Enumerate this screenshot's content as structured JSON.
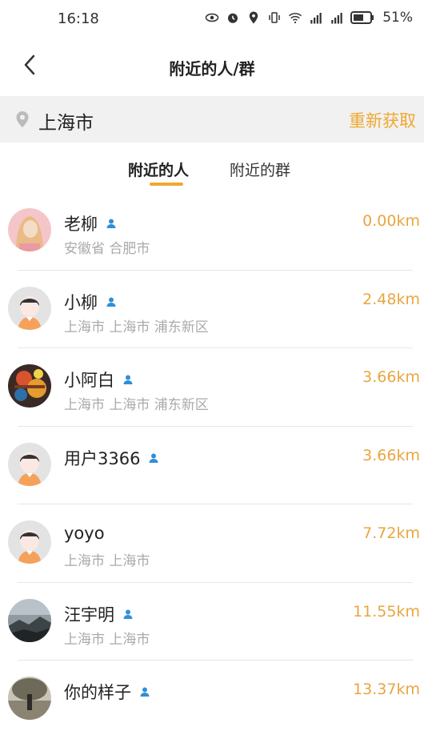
{
  "status": {
    "time": "16:18",
    "battery": "51%"
  },
  "header": {
    "title": "附近的人/群"
  },
  "location": {
    "city": "上海市",
    "refresh_label": "重新获取"
  },
  "tabs": [
    {
      "label": "附近的人",
      "active": true
    },
    {
      "label": "附近的群",
      "active": false
    }
  ],
  "colors": {
    "accent": "#f0a830",
    "distance": "#e8a640",
    "location_bar": "#f1f1f1"
  },
  "users": [
    {
      "name": "老柳",
      "verified": true,
      "address": "安徽省 合肥市",
      "distance": "0.00km",
      "avatar": "photo-girl"
    },
    {
      "name": "小柳",
      "verified": true,
      "address": "上海市 上海市 浦东新区",
      "distance": "2.48km",
      "avatar": "default"
    },
    {
      "name": "小阿白",
      "verified": true,
      "address": "上海市 上海市 浦东新区",
      "distance": "3.66km",
      "avatar": "photo-colorful"
    },
    {
      "name": "用户3366",
      "verified": true,
      "address": "",
      "distance": "3.66km",
      "avatar": "default"
    },
    {
      "name": "yoyo",
      "verified": false,
      "address": "上海市 上海市",
      "distance": "7.72km",
      "avatar": "default"
    },
    {
      "name": "汪宇明",
      "verified": true,
      "address": "上海市 上海市",
      "distance": "11.55km",
      "avatar": "photo-landscape"
    },
    {
      "name": "你的样子",
      "verified": true,
      "address": "",
      "distance": "13.37km",
      "avatar": "photo-outdoor"
    }
  ]
}
